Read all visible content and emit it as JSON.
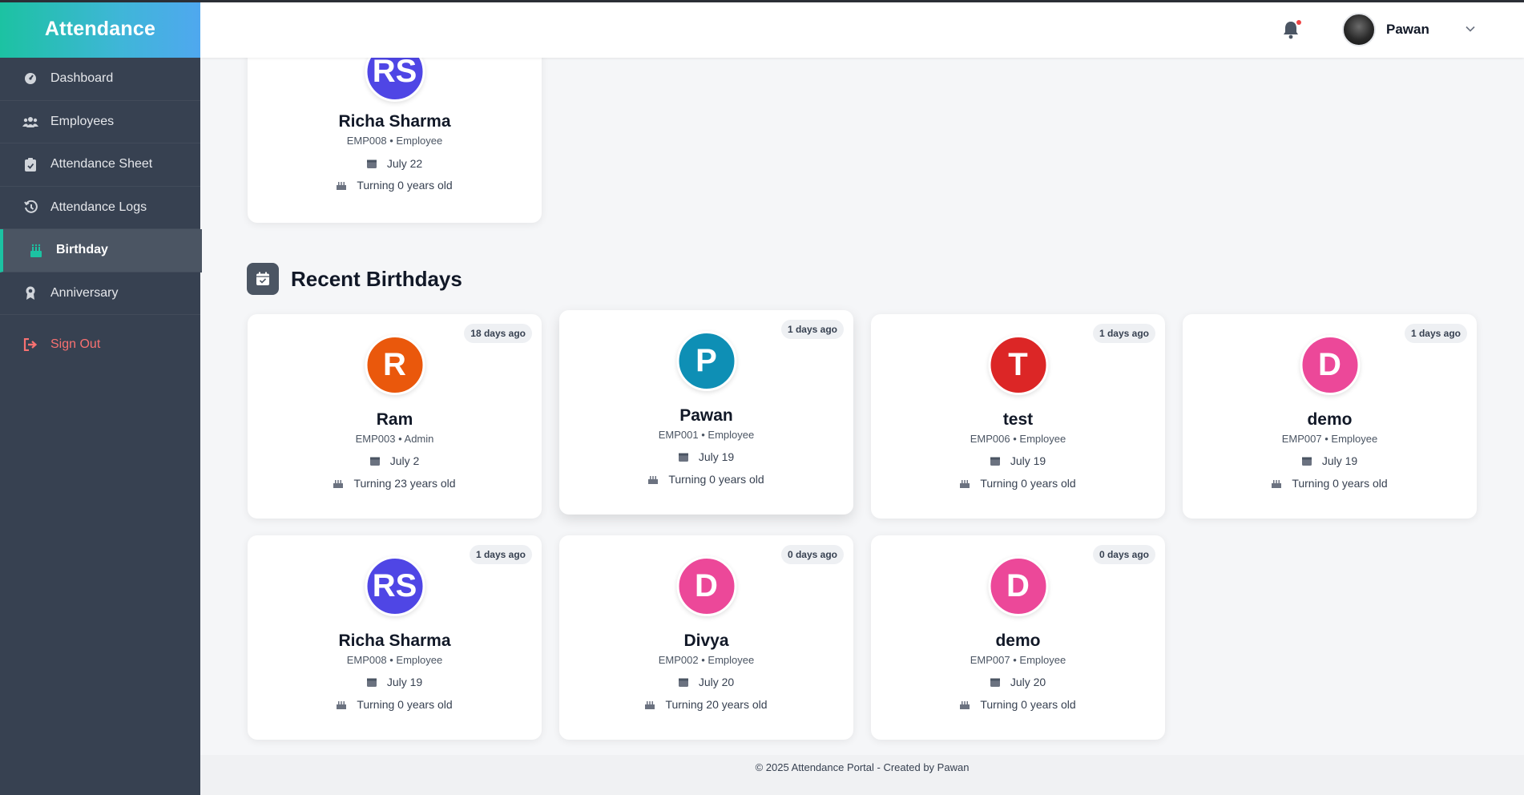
{
  "sidebar": {
    "brand": "Attendance",
    "items": [
      {
        "label": "Dashboard",
        "icon": "dashboard-icon"
      },
      {
        "label": "Employees",
        "icon": "users-icon"
      },
      {
        "label": "Attendance Sheet",
        "icon": "clipboard-icon"
      },
      {
        "label": "Attendance Logs",
        "icon": "history-icon"
      },
      {
        "label": "Birthday",
        "icon": "cake-icon",
        "active": true
      },
      {
        "label": "Anniversary",
        "icon": "award-icon"
      }
    ],
    "signout": "Sign Out"
  },
  "header": {
    "user_name": "Pawan",
    "notification_icon": "bell-icon"
  },
  "upcoming": {
    "card": {
      "initials": "RS",
      "color": "#4f46e5",
      "name": "Richa Sharma",
      "sub": "EMP008 • Employee",
      "date": "July 22",
      "age": "Turning 0 years old"
    }
  },
  "recent": {
    "title": "Recent Birthdays",
    "cards": [
      {
        "initials": "R",
        "color": "#ea580c",
        "name": "Ram",
        "sub": "EMP003 • Admin",
        "date": "July 2",
        "age": "Turning 23 years old",
        "badge": "18 days ago"
      },
      {
        "initials": "P",
        "color": "#0e8fb5",
        "name": "Pawan",
        "sub": "EMP001 • Employee",
        "date": "July 19",
        "age": "Turning 0 years old",
        "badge": "1 days ago"
      },
      {
        "initials": "T",
        "color": "#dc2626",
        "name": "test",
        "sub": "EMP006 • Employee",
        "date": "July 19",
        "age": "Turning 0 years old",
        "badge": "1 days ago"
      },
      {
        "initials": "D",
        "color": "#ec4899",
        "name": "demo",
        "sub": "EMP007 • Employee",
        "date": "July 19",
        "age": "Turning 0 years old",
        "badge": "1 days ago"
      },
      {
        "initials": "RS",
        "color": "#4f46e5",
        "name": "Richa Sharma",
        "sub": "EMP008 • Employee",
        "date": "July 19",
        "age": "Turning 0 years old",
        "badge": "1 days ago"
      },
      {
        "initials": "D",
        "color": "#ec4899",
        "name": "Divya",
        "sub": "EMP002 • Employee",
        "date": "July 20",
        "age": "Turning 20 years old",
        "badge": "0 days ago"
      },
      {
        "initials": "D",
        "color": "#ec4899",
        "name": "demo",
        "sub": "EMP007 • Employee",
        "date": "July 20",
        "age": "Turning 0 years old",
        "badge": "0 days ago"
      }
    ]
  },
  "footer": {
    "text": "© 2025 Attendance Portal - Created by Pawan"
  }
}
